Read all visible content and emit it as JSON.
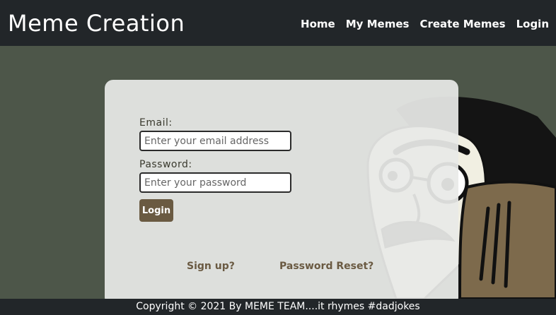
{
  "navbar": {
    "brand": "Meme Creation",
    "links": [
      {
        "label": "Home"
      },
      {
        "label": "My Memes"
      },
      {
        "label": "Create Memes"
      },
      {
        "label": "Login"
      }
    ]
  },
  "login_form": {
    "email_label": "Email:",
    "email_placeholder": "Enter your email address",
    "email_value": "",
    "password_label": "Password:",
    "password_placeholder": "Enter your password",
    "password_value": "",
    "submit_label": "Login",
    "signup_link": "Sign up?",
    "reset_link": "Password Reset?"
  },
  "footer": {
    "copyright": "Copyright © 2021 By MEME TEAM....it rhymes #dadjokes"
  },
  "colors": {
    "navbar_bg": "#222629",
    "page_bg": "#4d5649",
    "accent_brown": "#6a5a42"
  }
}
